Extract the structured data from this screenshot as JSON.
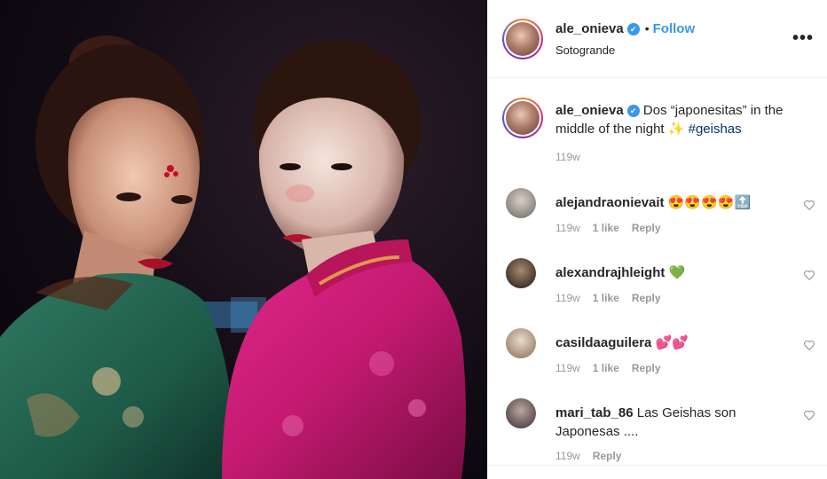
{
  "post": {
    "username": "ale_onieva",
    "verified_mark": "✔",
    "follow_label": "Follow",
    "location": "Sotogrande",
    "more_label": "•••",
    "caption": {
      "username": "ale_onieva",
      "text": "Dos “japonesitas” in the middle of the night ",
      "emoji": "✨",
      "hashtag": "#geishas",
      "time": "119w"
    }
  },
  "comments": [
    {
      "username": "alejandraonievait",
      "text": "😍😍😍😍🔝",
      "time": "119w",
      "likes": "1 like",
      "reply": "Reply"
    },
    {
      "username": "alexandrajhleight",
      "text": "💚",
      "time": "119w",
      "likes": "1 like",
      "reply": "Reply"
    },
    {
      "username": "casildaaguilera",
      "text": "💕💕",
      "time": "119w",
      "likes": "1 like",
      "reply": "Reply"
    },
    {
      "username": "mari_tab_86",
      "text": "Las Geishas son Japonesas ....",
      "time": "119w",
      "likes": "",
      "reply": "Reply"
    }
  ],
  "colors": {
    "link": "#3897f0",
    "hashtag": "#003569",
    "muted": "#999999"
  }
}
